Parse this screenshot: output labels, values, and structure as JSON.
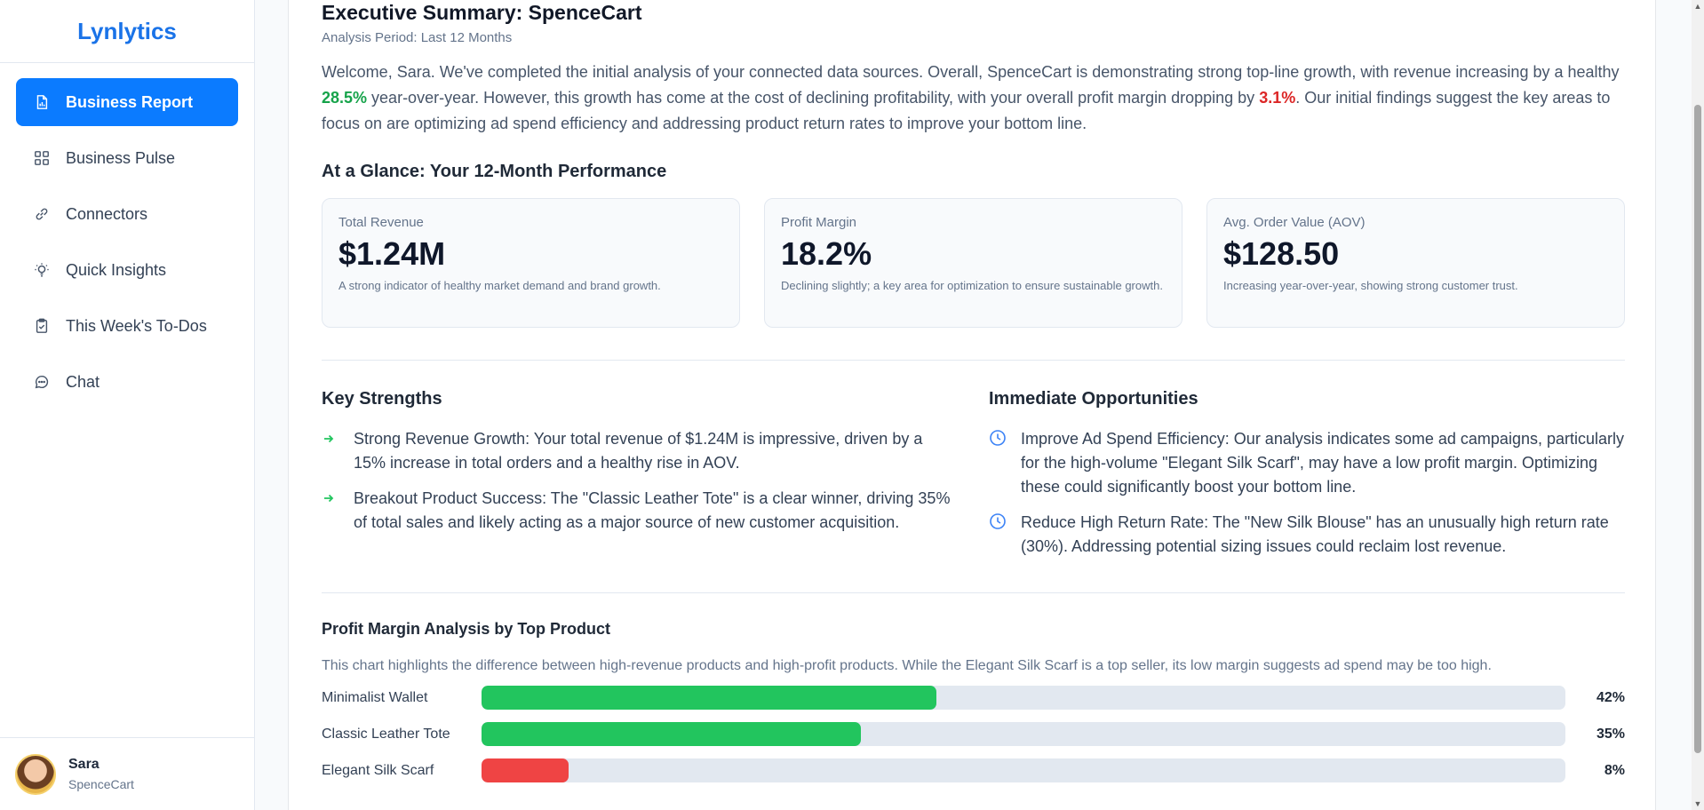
{
  "app": {
    "logo": "Lynlytics"
  },
  "sidebar": {
    "items": [
      {
        "label": "Business Report",
        "icon": "report-icon",
        "active": true
      },
      {
        "label": "Business Pulse",
        "icon": "grid-icon",
        "active": false
      },
      {
        "label": "Connectors",
        "icon": "link-icon",
        "active": false
      },
      {
        "label": "Quick Insights",
        "icon": "lightbulb-icon",
        "active": false
      },
      {
        "label": "This Week's To-Dos",
        "icon": "clipboard-check-icon",
        "active": false
      },
      {
        "label": "Chat",
        "icon": "chat-icon",
        "active": false
      }
    ],
    "user": {
      "name": "Sara",
      "company": "SpenceCart"
    }
  },
  "report": {
    "title": "Executive Summary: SpenceCart",
    "period": "Analysis Period: Last 12 Months",
    "intro": {
      "part1": "Welcome, Sara. We've completed the initial analysis of your connected data sources. Overall, SpenceCart is demonstrating strong top-line growth, with revenue increasing by a healthy ",
      "growth": "28.5%",
      "part2": " year-over-year. However, this growth has come at the cost of declining profitability, with your overall profit margin dropping by ",
      "drop": "3.1%",
      "part3": ". Our initial findings suggest the key areas to focus on are optimizing ad spend efficiency and addressing product return rates to improve your bottom line."
    },
    "glance": {
      "title": "At a Glance: Your 12-Month Performance",
      "cards": [
        {
          "label": "Total Revenue",
          "value": "$1.24M",
          "desc": "A strong indicator of healthy market demand and brand growth."
        },
        {
          "label": "Profit Margin",
          "value": "18.2%",
          "desc": "Declining slightly; a key area for optimization to ensure sustainable growth."
        },
        {
          "label": "Avg. Order Value (AOV)",
          "value": "$128.50",
          "desc": "Increasing year-over-year, showing strong customer trust."
        }
      ]
    },
    "strengths": {
      "title": "Key Strengths",
      "items": [
        "Strong Revenue Growth: Your total revenue of $1.24M is impressive, driven by a 15% increase in total orders and a healthy rise in AOV.",
        "Breakout Product Success: The \"Classic Leather Tote\" is a clear winner, driving 35% of total sales and likely acting as a major source of new customer acquisition."
      ]
    },
    "opportunities": {
      "title": "Immediate Opportunities",
      "items": [
        "Improve Ad Spend Efficiency: Our analysis indicates some ad campaigns, particularly for the high-volume \"Elegant Silk Scarf\", may have a low profit margin. Optimizing these could significantly boost your bottom line.",
        "Reduce High Return Rate: The \"New Silk Blouse\" has an unusually high return rate (30%). Addressing potential sizing issues could reclaim lost revenue."
      ]
    },
    "margin_chart": {
      "title": "Profit Margin Analysis by Top Product",
      "desc": "This chart highlights the difference between high-revenue products and high-profit products. While the Elegant Silk Scarf is a top seller, its low margin suggests ad spend may be too high."
    }
  },
  "colors": {
    "accent": "#0b7bff",
    "positive": "#22c55e",
    "negative": "#ef4444",
    "track": "#e2e8f0"
  },
  "chart_data": {
    "type": "bar",
    "orientation": "horizontal",
    "title": "Profit Margin Analysis by Top Product",
    "categories": [
      "Minimalist Wallet",
      "Classic Leather Tote",
      "Elegant Silk Scarf"
    ],
    "values": [
      42,
      35,
      8
    ],
    "value_labels": [
      "42%",
      "35%",
      "8%"
    ],
    "bar_colors": [
      "#22c55e",
      "#22c55e",
      "#ef4444"
    ],
    "xlim": [
      0,
      100
    ]
  }
}
